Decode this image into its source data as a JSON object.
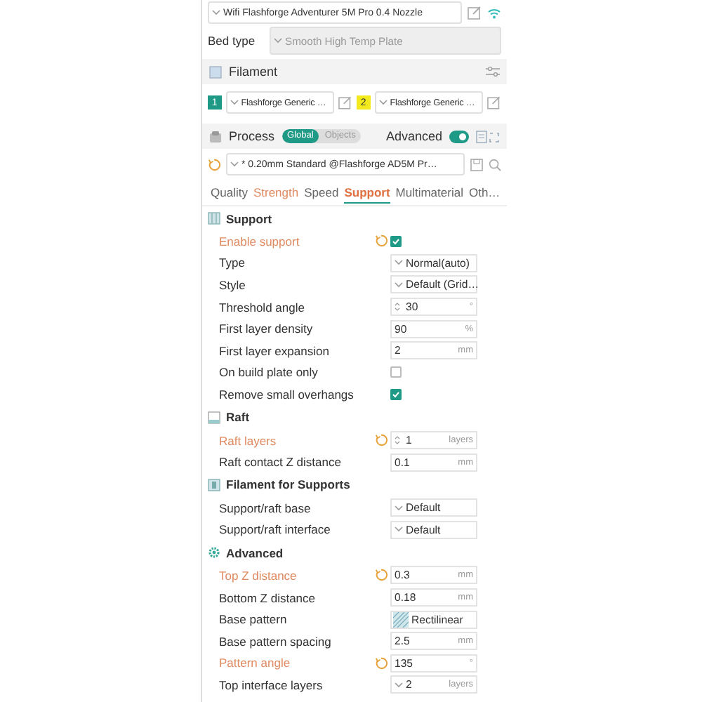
{
  "printer": {
    "value": "Wifi Flashforge Adventurer 5M Pro 0.4 Nozzle"
  },
  "bed_type": {
    "label": "Bed type",
    "value": "Smooth High Temp Plate"
  },
  "filament": {
    "title": "Filament",
    "slots": [
      {
        "number": "1",
        "color": "#1f9a86",
        "value": "Flashforge Generic …"
      },
      {
        "number": "2",
        "color": "#f2ea1c",
        "value": "Flashforge Generic …"
      }
    ]
  },
  "process": {
    "title": "Process",
    "scopes": [
      {
        "label": "Global",
        "selected": true
      },
      {
        "label": "Objects",
        "selected": false
      }
    ],
    "advanced": {
      "label": "Advanced",
      "on": true
    }
  },
  "preset": {
    "value": "* 0.20mm Standard @Flashforge AD5M Pr…"
  },
  "tabs": [
    {
      "label": "Quality",
      "selected": false,
      "modified": false
    },
    {
      "label": "Strength",
      "selected": false,
      "modified": true
    },
    {
      "label": "Speed",
      "selected": false,
      "modified": false
    },
    {
      "label": "Support",
      "selected": true,
      "modified": true
    },
    {
      "label": "Multimaterial",
      "selected": false,
      "modified": false
    },
    {
      "label": "Oth…",
      "selected": false,
      "modified": false
    }
  ],
  "sections": [
    {
      "title": "Support",
      "kind": "support",
      "rows": [
        {
          "label": "Enable support",
          "kind": "checkbox",
          "modified": true,
          "checked": true
        },
        {
          "label": "Type",
          "kind": "combo",
          "modified": false,
          "value": "Normal(auto)"
        },
        {
          "label": "Style",
          "kind": "combo",
          "modified": false,
          "value": "Default (Grid…"
        },
        {
          "label": "Threshold angle",
          "kind": "spin",
          "modified": false,
          "value": "30",
          "unit": "°"
        },
        {
          "label": "First layer density",
          "kind": "number",
          "modified": false,
          "value": "90",
          "unit": "%"
        },
        {
          "label": "First layer expansion",
          "kind": "number",
          "modified": false,
          "value": "2",
          "unit": "mm"
        },
        {
          "label": "On build plate only",
          "kind": "checkbox",
          "modified": false,
          "checked": false
        },
        {
          "label": "Remove small overhangs",
          "kind": "checkbox",
          "modified": false,
          "checked": true
        }
      ]
    },
    {
      "title": "Raft",
      "kind": "raft",
      "rows": [
        {
          "label": "Raft layers",
          "kind": "spin",
          "modified": true,
          "value": "1",
          "unit": "layers"
        },
        {
          "label": "Raft contact Z distance",
          "kind": "number",
          "modified": false,
          "value": "0.1",
          "unit": "mm"
        }
      ]
    },
    {
      "title": "Filament for Supports",
      "kind": "filament",
      "rows": [
        {
          "label": "Support/raft base",
          "kind": "combo",
          "modified": false,
          "value": "Default"
        },
        {
          "label": "Support/raft interface",
          "kind": "combo",
          "modified": false,
          "value": "Default"
        }
      ]
    },
    {
      "title": "Advanced",
      "kind": "advanced",
      "rows": [
        {
          "label": "Top Z distance",
          "kind": "number",
          "modified": true,
          "value": "0.3",
          "unit": "mm"
        },
        {
          "label": "Bottom Z distance",
          "kind": "number",
          "modified": false,
          "value": "0.18",
          "unit": "mm"
        },
        {
          "label": "Base pattern",
          "kind": "pattern",
          "modified": false,
          "value": "Rectilinear"
        },
        {
          "label": "Base pattern spacing",
          "kind": "number",
          "modified": false,
          "value": "2.5",
          "unit": "mm"
        },
        {
          "label": "Pattern angle",
          "kind": "number",
          "modified": true,
          "value": "135",
          "unit": "°"
        },
        {
          "label": "Top interface layers",
          "kind": "combo",
          "modified": false,
          "value": "2",
          "unit": "layers"
        }
      ]
    }
  ]
}
